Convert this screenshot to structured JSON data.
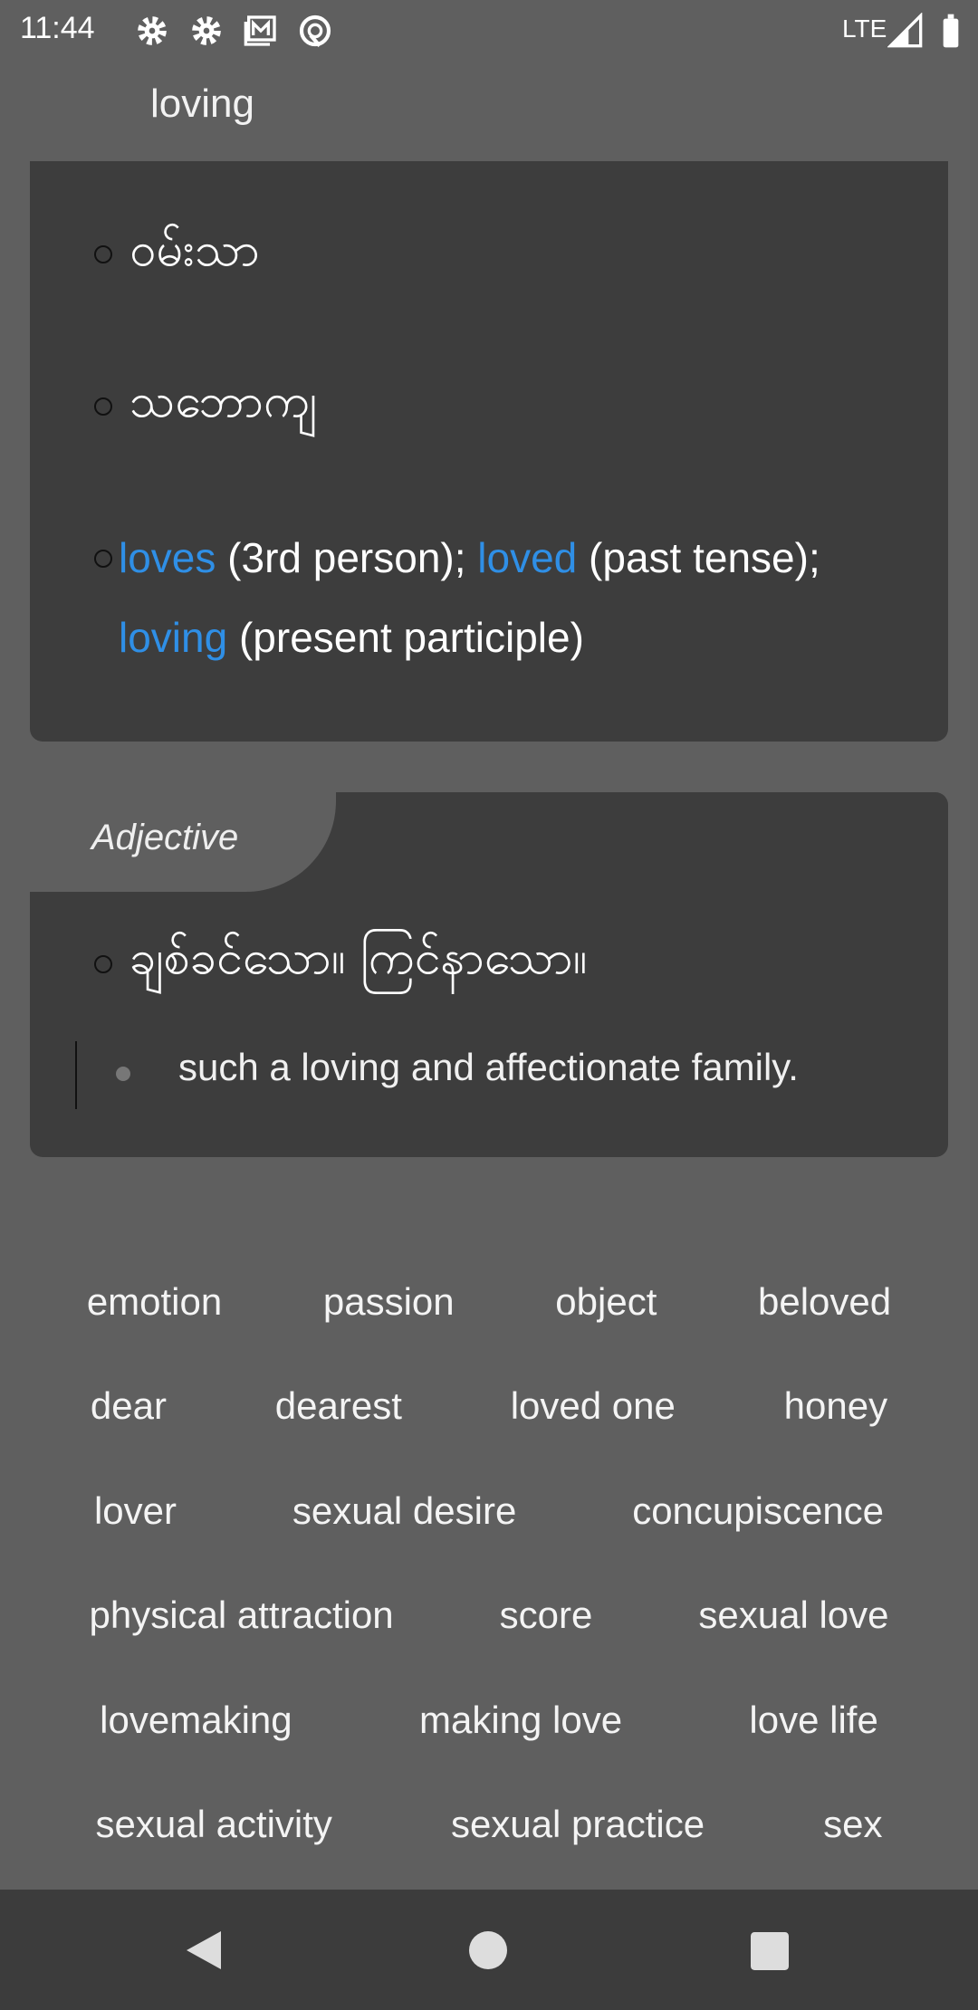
{
  "status_bar": {
    "time": "11:44",
    "network": "LTE",
    "icons": [
      "gear-icon",
      "gear-icon",
      "gmail-icon",
      "assistant-icon",
      "signal-icon",
      "battery-icon"
    ]
  },
  "header": {
    "title": "loving"
  },
  "card1": {
    "items": [
      "ဝမ်းသာ",
      "သဘောကျ"
    ],
    "forms": {
      "w1": "loves",
      "t1": " (3rd person); ",
      "w2": "loved",
      "t2": " (past tense); ",
      "w3": "loving",
      "t3": " (present participle)"
    }
  },
  "card2": {
    "pos": "Adjective",
    "definition": "ချစ်ခင်သော။ ကြင်နာသော။",
    "example": "such a loving and affectionate family."
  },
  "related": [
    [
      "emotion",
      "passion",
      "object",
      "beloved"
    ],
    [
      "dear",
      "dearest",
      "loved one",
      "honey"
    ],
    [
      "lover",
      "sexual desire",
      "concupiscence"
    ],
    [
      "physical attraction",
      "score",
      "sexual love"
    ],
    [
      "lovemaking",
      "making love",
      "love life"
    ],
    [
      "sexual activity",
      "sexual practice",
      "sex"
    ]
  ],
  "colors": {
    "link": "#2f8fe6",
    "background": "#5f5f5f",
    "card": "#3d3d3d"
  }
}
